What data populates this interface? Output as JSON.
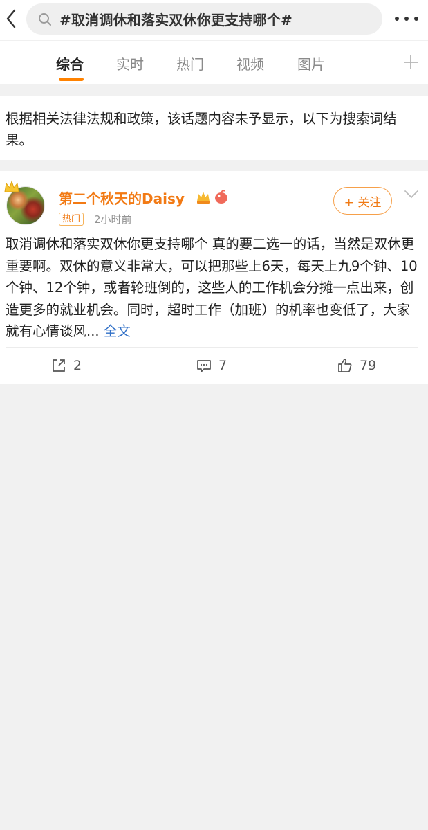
{
  "search": {
    "query": "#取消调休和落实双休你更支持哪个#"
  },
  "tabs": [
    {
      "label": "综合",
      "active": true
    },
    {
      "label": "实时",
      "active": false
    },
    {
      "label": "热门",
      "active": false
    },
    {
      "label": "视频",
      "active": false
    },
    {
      "label": "图片",
      "active": false
    }
  ],
  "notice": {
    "text": "根据相关法律法规和政策，该话题内容未予显示，以下为搜索词结果。"
  },
  "post": {
    "username": "第二个秋天的Daisy",
    "tag": "热门",
    "time": "2小时前",
    "follow_label": "+ 关注",
    "body": "取消调休和落实双休你更支持哪个  真的要二选一的话，当然是双休更重要啊。双休的意义非常大，可以把那些上6天，每天上九9个钟、10个钟、12个钟，或者轮班倒的，这些人的工作机会分摊一点出来，创造更多的就业机会。同时，超时工作（加班）的机率也变低了，大家就有心情谈风...",
    "fulltext_label": "全文",
    "reposts": "2",
    "comments": "7",
    "likes": "79"
  },
  "colors": {
    "accent": "#ff8200",
    "username": "#f27a14",
    "link": "#3170c7",
    "background": "#f1f1f1"
  },
  "icons": [
    "back-arrow-icon",
    "search-icon",
    "more-icon",
    "add-tab-icon",
    "crown-icon",
    "vip-badge-icon",
    "chick-badge-icon",
    "chevron-down-icon",
    "repost-icon",
    "comment-icon",
    "like-icon"
  ]
}
